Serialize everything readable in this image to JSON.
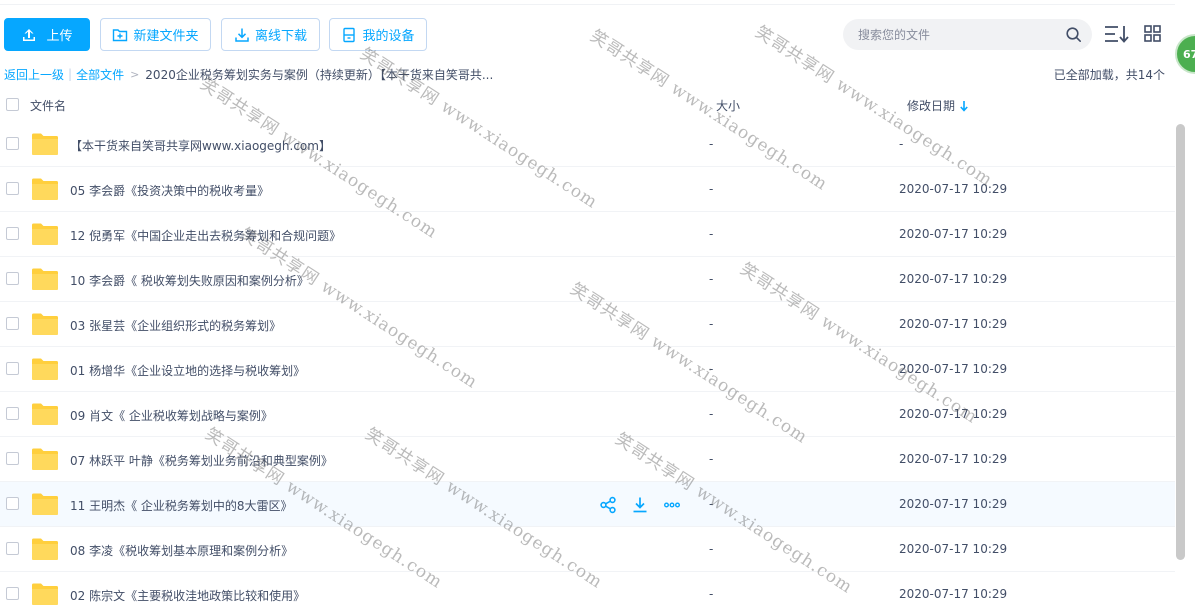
{
  "toolbar": {
    "upload_label": "上传",
    "new_folder_label": "新建文件夹",
    "offline_download_label": "离线下载",
    "my_device_label": "我的设备"
  },
  "search": {
    "placeholder": "搜索您的文件"
  },
  "badge": {
    "text": "67"
  },
  "breadcrumb": {
    "back_label": "返回上一级",
    "all_files_label": "全部文件",
    "current_path": "2020企业税务筹划实务与案例（持续更新）【本干货来自笑哥共..."
  },
  "status": {
    "loaded_text": "已全部加载，共14个"
  },
  "table": {
    "col_name": "文件名",
    "col_size": "大小",
    "col_date": "修改日期",
    "rows": [
      {
        "name": "【本干货来自笑哥共享网www.xiaogegh.com】",
        "size": "-",
        "date": "-"
      },
      {
        "name": "05 李会爵《投资决策中的税收考量》",
        "size": "-",
        "date": "2020-07-17 10:29"
      },
      {
        "name": "12 倪勇军《中国企业走出去税务筹划和合规问题》",
        "size": "-",
        "date": "2020-07-17 10:29"
      },
      {
        "name": "10 李会爵《 税收筹划失败原因和案例分析》",
        "size": "-",
        "date": "2020-07-17 10:29"
      },
      {
        "name": "03 张星芸《企业组织形式的税务筹划》",
        "size": "-",
        "date": "2020-07-17 10:29"
      },
      {
        "name": "01 杨增华《企业设立地的选择与税收筹划》",
        "size": "-",
        "date": "2020-07-17 10:29"
      },
      {
        "name": "09 肖文《 企业税收筹划战略与案例》",
        "size": "-",
        "date": "2020-07-17 10:29"
      },
      {
        "name": "07 林跃平 叶静《税务筹划业务前沿和典型案例》",
        "size": "-",
        "date": "2020-07-17 10:29"
      },
      {
        "name": "11 王明杰《 企业税务筹划中的8大雷区》",
        "size": "-",
        "date": "2020-07-17 10:29"
      },
      {
        "name": "08 李凌《税收筹划基本原理和案例分析》",
        "size": "-",
        "date": "2020-07-17 10:29"
      },
      {
        "name": "02 陈宗文《主要税收洼地政策比较和使用》",
        "size": "-",
        "date": "2020-07-17 10:29"
      }
    ]
  },
  "watermark": {
    "text": "笑哥共享网 www.xiaogegh.com"
  },
  "colors": {
    "accent": "#06a7ff",
    "folder": "#ffcf3d",
    "text": "#424e67"
  }
}
